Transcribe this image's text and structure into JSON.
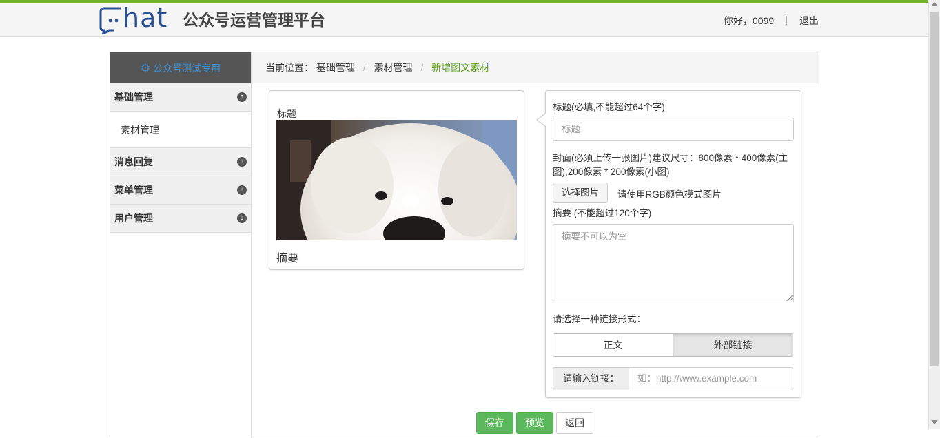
{
  "header": {
    "logo_text": "hat",
    "platform_title": "公众号运营管理平台",
    "greeting": "你好，0099",
    "separator": "|",
    "logout_label": "退出"
  },
  "sidebar": {
    "account_name": "公众号测试专用",
    "items": [
      {
        "label": "基础管理",
        "expanded": true,
        "children": [
          {
            "label": "素材管理"
          }
        ]
      },
      {
        "label": "消息回复",
        "expanded": false
      },
      {
        "label": "菜单管理",
        "expanded": false
      },
      {
        "label": "用户管理",
        "expanded": false
      }
    ]
  },
  "breadcrumb": {
    "prefix": "当前位置：",
    "items": [
      "基础管理",
      "素材管理",
      "新增图文素材"
    ],
    "separator": "/"
  },
  "preview": {
    "title": "标题",
    "summary": "摘要"
  },
  "form": {
    "title_label": "标题(必填,不能超过64个字)",
    "title_placeholder": "标题",
    "cover_label": "封面(必须上传一张图片)建议尺寸：800像素 * 400像素(主图),200像素 * 200像素(小图)",
    "choose_image_label": "选择图片",
    "rgb_hint": "请使用RGB颜色模式图片",
    "summary_label": "摘要 (不能超过120个字)",
    "summary_placeholder": "摘要不可以为空",
    "link_type_label": "请选择一种链接形式：",
    "link_options": [
      "正文",
      "外部链接"
    ],
    "selected_link_option": "外部链接",
    "link_addon": "请输入链接：",
    "link_placeholder": "如：http://www.example.com"
  },
  "actions": {
    "save_label": "保存",
    "preview_label": "预览",
    "back_label": "返回"
  },
  "colors": {
    "accent_green": "#73b52a",
    "breadcrumb_active": "#5ca219",
    "account_text": "#3d8fd6",
    "logo_blue": "#2a4f95",
    "button_green": "#5cb85c"
  }
}
